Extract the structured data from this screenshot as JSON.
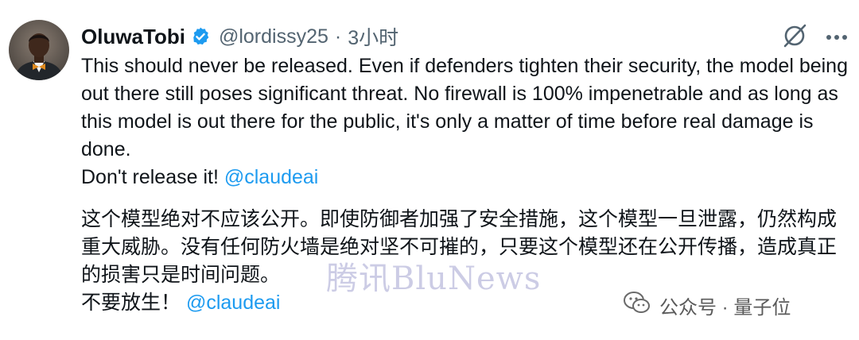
{
  "tweet": {
    "author_name": "OluwaTobi",
    "handle": "@lordissy25",
    "separator": "·",
    "time": "3小时",
    "en_text": "This should never be released. Even if defenders tighten their security, the model being out there still poses significant threat. No firewall is 100% impenetrable and as long as this model is out there for the public, it's only a matter of time before real damage is done.",
    "en_cta": "Don't release it! ",
    "en_mention": "@claudeai",
    "cn_text": "这个模型绝对不应该公开。即使防御者加强了安全措施，这个模型一旦泄露，仍然构成重大威胁。没有任何防火墙是绝对坚不可摧的，只要这个模型还在公开传播，造成真正的损害只是时间问题。",
    "cn_cta": "不要放生！ ",
    "cn_mention": "@claudeai"
  },
  "icons": {
    "verified": "verified-badge-icon",
    "grok": "grok-icon",
    "more": "more-icon",
    "wechat": "wechat-icon"
  },
  "watermark": "腾讯BluNews",
  "source_label": "公众号 · 量子位",
  "colors": {
    "text": "#0f1419",
    "secondary": "#536471",
    "link": "#1d9bf0",
    "verified": "#1d9bf0"
  }
}
